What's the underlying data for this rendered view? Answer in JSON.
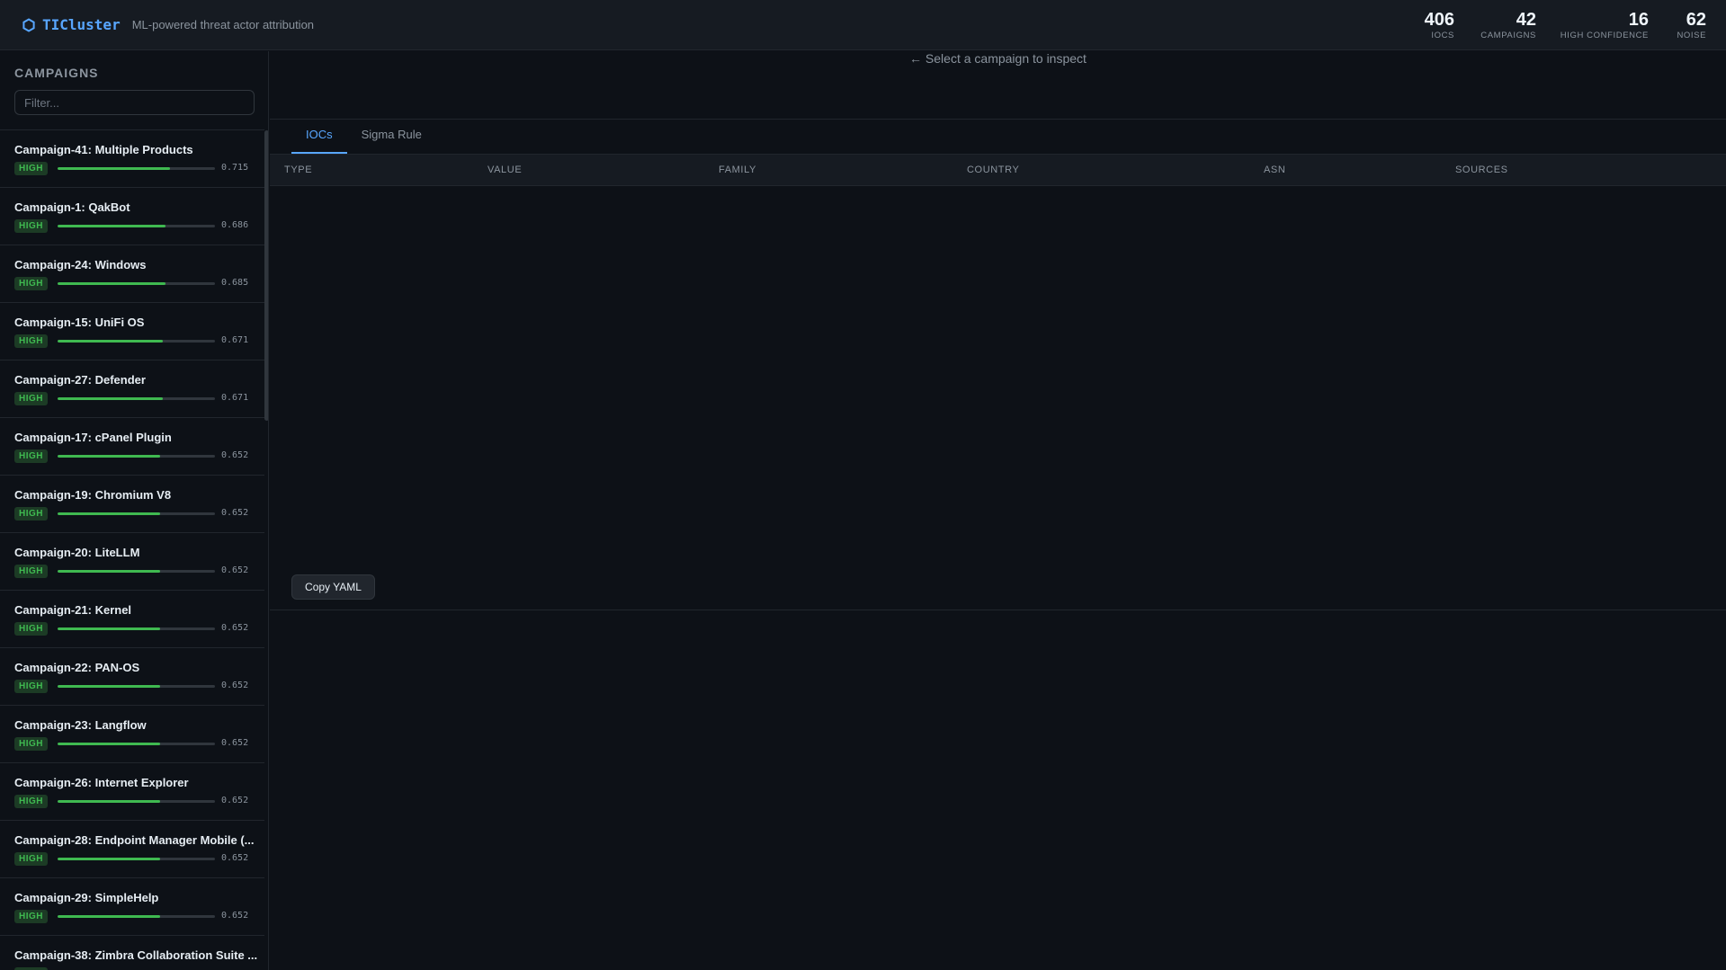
{
  "header": {
    "logo_icon": "hexagon-icon",
    "title": "TICluster",
    "subtitle": "ML-powered threat actor attribution",
    "stats": [
      {
        "value": "406",
        "label": "IOCS"
      },
      {
        "value": "42",
        "label": "CAMPAIGNS"
      },
      {
        "value": "16",
        "label": "HIGH CONFIDENCE"
      },
      {
        "value": "62",
        "label": "NOISE"
      }
    ]
  },
  "sidebar": {
    "title": "CAMPAIGNS",
    "filter_placeholder": "Filter...",
    "campaigns": [
      {
        "name": "Campaign-41: Multiple Products",
        "confidence": "HIGH",
        "score": "0.715"
      },
      {
        "name": "Campaign-1: QakBot",
        "confidence": "HIGH",
        "score": "0.686"
      },
      {
        "name": "Campaign-24: Windows",
        "confidence": "HIGH",
        "score": "0.685"
      },
      {
        "name": "Campaign-15: UniFi OS",
        "confidence": "HIGH",
        "score": "0.671"
      },
      {
        "name": "Campaign-27: Defender",
        "confidence": "HIGH",
        "score": "0.671"
      },
      {
        "name": "Campaign-17: cPanel Plugin",
        "confidence": "HIGH",
        "score": "0.652"
      },
      {
        "name": "Campaign-19: Chromium V8",
        "confidence": "HIGH",
        "score": "0.652"
      },
      {
        "name": "Campaign-20: LiteLLM",
        "confidence": "HIGH",
        "score": "0.652"
      },
      {
        "name": "Campaign-21: Kernel",
        "confidence": "HIGH",
        "score": "0.652"
      },
      {
        "name": "Campaign-22: PAN-OS",
        "confidence": "HIGH",
        "score": "0.652"
      },
      {
        "name": "Campaign-23: Langflow",
        "confidence": "HIGH",
        "score": "0.652"
      },
      {
        "name": "Campaign-26: Internet Explorer",
        "confidence": "HIGH",
        "score": "0.652"
      },
      {
        "name": "Campaign-28: Endpoint Manager Mobile (...",
        "confidence": "HIGH",
        "score": "0.652"
      },
      {
        "name": "Campaign-29: SimpleHelp",
        "confidence": "HIGH",
        "score": "0.652"
      },
      {
        "name": "Campaign-38: Zimbra Collaboration Suite ...",
        "confidence": "HIGH",
        "score": ""
      }
    ]
  },
  "main": {
    "hint": "← Select a campaign to inspect",
    "tabs": [
      {
        "label": "IOCs",
        "active": true
      },
      {
        "label": "Sigma Rule",
        "active": false
      }
    ],
    "columns": [
      "TYPE",
      "VALUE",
      "FAMILY",
      "COUNTRY",
      "ASN",
      "SOURCES"
    ],
    "copy_button": "Copy YAML"
  },
  "colors": {
    "accent": "#58a6ff",
    "high": "#3fb950",
    "background": "#0d1117"
  }
}
